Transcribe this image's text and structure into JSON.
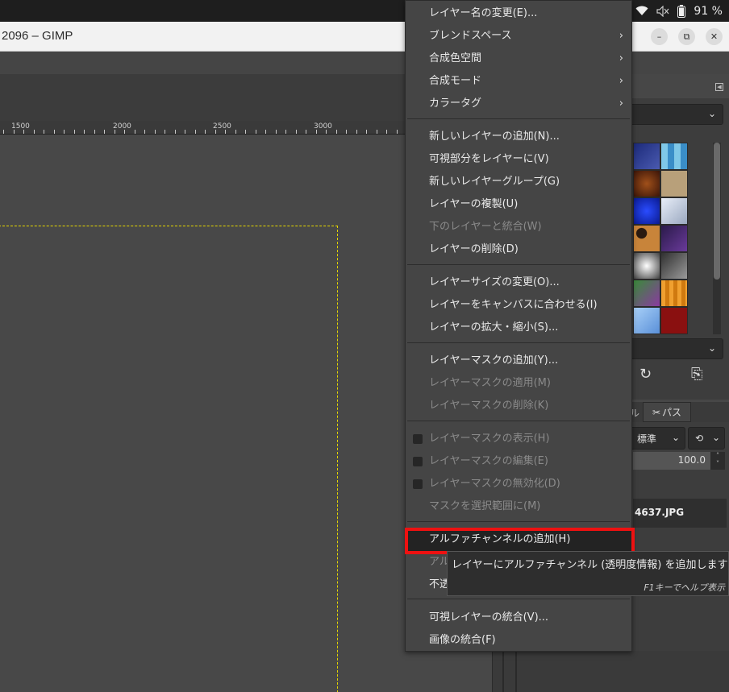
{
  "system": {
    "battery": "91 %"
  },
  "window": {
    "title": "2096 – GIMP"
  },
  "ruler": {
    "labels": [
      "1500",
      "2000",
      "2500",
      "3000"
    ]
  },
  "dock": {
    "mode_label": "標準",
    "opacity": "100.0",
    "tab_label": "パス",
    "tab_partial": "ル",
    "layer_name": "4637.JPG"
  },
  "menu": {
    "items": [
      {
        "label": "レイヤー名の変更(E)...",
        "enabled": true
      },
      {
        "label": "ブレンドスペース",
        "enabled": true,
        "submenu": true
      },
      {
        "label": "合成色空間",
        "enabled": true,
        "submenu": true
      },
      {
        "label": "合成モード",
        "enabled": true,
        "submenu": true
      },
      {
        "label": "カラータグ",
        "enabled": true,
        "submenu": true
      },
      {
        "label": "新しいレイヤーの追加(N)...",
        "enabled": true
      },
      {
        "label": "可視部分をレイヤーに(V)",
        "enabled": true
      },
      {
        "label": "新しいレイヤーグループ(G)",
        "enabled": true
      },
      {
        "label": "レイヤーの複製(U)",
        "enabled": true
      },
      {
        "label": "下のレイヤーと統合(W)",
        "enabled": false
      },
      {
        "label": "レイヤーの削除(D)",
        "enabled": true
      },
      {
        "label": "レイヤーサイズの変更(O)...",
        "enabled": true
      },
      {
        "label": "レイヤーをキャンバスに合わせる(I)",
        "enabled": true
      },
      {
        "label": "レイヤーの拡大・縮小(S)...",
        "enabled": true
      },
      {
        "label": "レイヤーマスクの追加(Y)...",
        "enabled": true
      },
      {
        "label": "レイヤーマスクの適用(M)",
        "enabled": false
      },
      {
        "label": "レイヤーマスクの削除(K)",
        "enabled": false
      },
      {
        "label": "レイヤーマスクの表示(H)",
        "enabled": false,
        "checkbox": true
      },
      {
        "label": "レイヤーマスクの編集(E)",
        "enabled": false,
        "checkbox": true
      },
      {
        "label": "レイヤーマスクの無効化(D)",
        "enabled": false,
        "checkbox": true
      },
      {
        "label": "マスクを選択範囲に(M)",
        "enabled": false
      },
      {
        "label": "アルファチャンネルの追加(H)",
        "enabled": true,
        "highlighted": true
      },
      {
        "label": "アルファ",
        "enabled": false
      },
      {
        "label": "不透明部分を選択範囲に(P)",
        "enabled": true
      },
      {
        "label": "可視レイヤーの統合(V)...",
        "enabled": true
      },
      {
        "label": "画像の統合(F)",
        "enabled": true
      }
    ]
  },
  "tooltip": {
    "text": "レイヤーにアルファチャンネル (透明度情報) を追加します",
    "help": "F1キーでヘルプ表示"
  },
  "colors": {
    "highlight_border": "#ee1111",
    "selection_dash": "#e6d700"
  }
}
